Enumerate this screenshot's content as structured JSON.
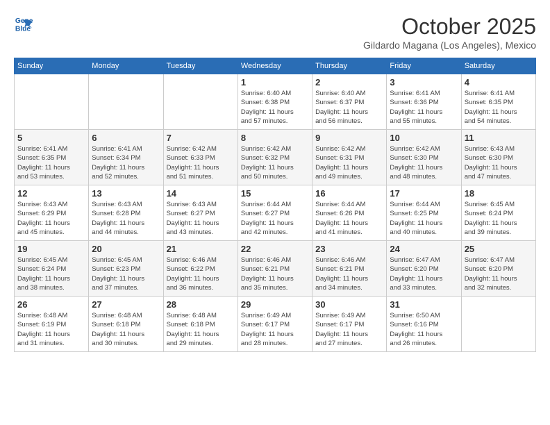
{
  "header": {
    "logo_line1": "General",
    "logo_line2": "Blue",
    "title": "October 2025",
    "subtitle": "Gildardo Magana (Los Angeles), Mexico"
  },
  "weekdays": [
    "Sunday",
    "Monday",
    "Tuesday",
    "Wednesday",
    "Thursday",
    "Friday",
    "Saturday"
  ],
  "rows": [
    [
      {
        "day": "",
        "info": ""
      },
      {
        "day": "",
        "info": ""
      },
      {
        "day": "",
        "info": ""
      },
      {
        "day": "1",
        "info": "Sunrise: 6:40 AM\nSunset: 6:38 PM\nDaylight: 11 hours\nand 57 minutes."
      },
      {
        "day": "2",
        "info": "Sunrise: 6:40 AM\nSunset: 6:37 PM\nDaylight: 11 hours\nand 56 minutes."
      },
      {
        "day": "3",
        "info": "Sunrise: 6:41 AM\nSunset: 6:36 PM\nDaylight: 11 hours\nand 55 minutes."
      },
      {
        "day": "4",
        "info": "Sunrise: 6:41 AM\nSunset: 6:35 PM\nDaylight: 11 hours\nand 54 minutes."
      }
    ],
    [
      {
        "day": "5",
        "info": "Sunrise: 6:41 AM\nSunset: 6:35 PM\nDaylight: 11 hours\nand 53 minutes."
      },
      {
        "day": "6",
        "info": "Sunrise: 6:41 AM\nSunset: 6:34 PM\nDaylight: 11 hours\nand 52 minutes."
      },
      {
        "day": "7",
        "info": "Sunrise: 6:42 AM\nSunset: 6:33 PM\nDaylight: 11 hours\nand 51 minutes."
      },
      {
        "day": "8",
        "info": "Sunrise: 6:42 AM\nSunset: 6:32 PM\nDaylight: 11 hours\nand 50 minutes."
      },
      {
        "day": "9",
        "info": "Sunrise: 6:42 AM\nSunset: 6:31 PM\nDaylight: 11 hours\nand 49 minutes."
      },
      {
        "day": "10",
        "info": "Sunrise: 6:42 AM\nSunset: 6:30 PM\nDaylight: 11 hours\nand 48 minutes."
      },
      {
        "day": "11",
        "info": "Sunrise: 6:43 AM\nSunset: 6:30 PM\nDaylight: 11 hours\nand 47 minutes."
      }
    ],
    [
      {
        "day": "12",
        "info": "Sunrise: 6:43 AM\nSunset: 6:29 PM\nDaylight: 11 hours\nand 45 minutes."
      },
      {
        "day": "13",
        "info": "Sunrise: 6:43 AM\nSunset: 6:28 PM\nDaylight: 11 hours\nand 44 minutes."
      },
      {
        "day": "14",
        "info": "Sunrise: 6:43 AM\nSunset: 6:27 PM\nDaylight: 11 hours\nand 43 minutes."
      },
      {
        "day": "15",
        "info": "Sunrise: 6:44 AM\nSunset: 6:27 PM\nDaylight: 11 hours\nand 42 minutes."
      },
      {
        "day": "16",
        "info": "Sunrise: 6:44 AM\nSunset: 6:26 PM\nDaylight: 11 hours\nand 41 minutes."
      },
      {
        "day": "17",
        "info": "Sunrise: 6:44 AM\nSunset: 6:25 PM\nDaylight: 11 hours\nand 40 minutes."
      },
      {
        "day": "18",
        "info": "Sunrise: 6:45 AM\nSunset: 6:24 PM\nDaylight: 11 hours\nand 39 minutes."
      }
    ],
    [
      {
        "day": "19",
        "info": "Sunrise: 6:45 AM\nSunset: 6:24 PM\nDaylight: 11 hours\nand 38 minutes."
      },
      {
        "day": "20",
        "info": "Sunrise: 6:45 AM\nSunset: 6:23 PM\nDaylight: 11 hours\nand 37 minutes."
      },
      {
        "day": "21",
        "info": "Sunrise: 6:46 AM\nSunset: 6:22 PM\nDaylight: 11 hours\nand 36 minutes."
      },
      {
        "day": "22",
        "info": "Sunrise: 6:46 AM\nSunset: 6:21 PM\nDaylight: 11 hours\nand 35 minutes."
      },
      {
        "day": "23",
        "info": "Sunrise: 6:46 AM\nSunset: 6:21 PM\nDaylight: 11 hours\nand 34 minutes."
      },
      {
        "day": "24",
        "info": "Sunrise: 6:47 AM\nSunset: 6:20 PM\nDaylight: 11 hours\nand 33 minutes."
      },
      {
        "day": "25",
        "info": "Sunrise: 6:47 AM\nSunset: 6:20 PM\nDaylight: 11 hours\nand 32 minutes."
      }
    ],
    [
      {
        "day": "26",
        "info": "Sunrise: 6:48 AM\nSunset: 6:19 PM\nDaylight: 11 hours\nand 31 minutes."
      },
      {
        "day": "27",
        "info": "Sunrise: 6:48 AM\nSunset: 6:18 PM\nDaylight: 11 hours\nand 30 minutes."
      },
      {
        "day": "28",
        "info": "Sunrise: 6:48 AM\nSunset: 6:18 PM\nDaylight: 11 hours\nand 29 minutes."
      },
      {
        "day": "29",
        "info": "Sunrise: 6:49 AM\nSunset: 6:17 PM\nDaylight: 11 hours\nand 28 minutes."
      },
      {
        "day": "30",
        "info": "Sunrise: 6:49 AM\nSunset: 6:17 PM\nDaylight: 11 hours\nand 27 minutes."
      },
      {
        "day": "31",
        "info": "Sunrise: 6:50 AM\nSunset: 6:16 PM\nDaylight: 11 hours\nand 26 minutes."
      },
      {
        "day": "",
        "info": ""
      }
    ]
  ]
}
